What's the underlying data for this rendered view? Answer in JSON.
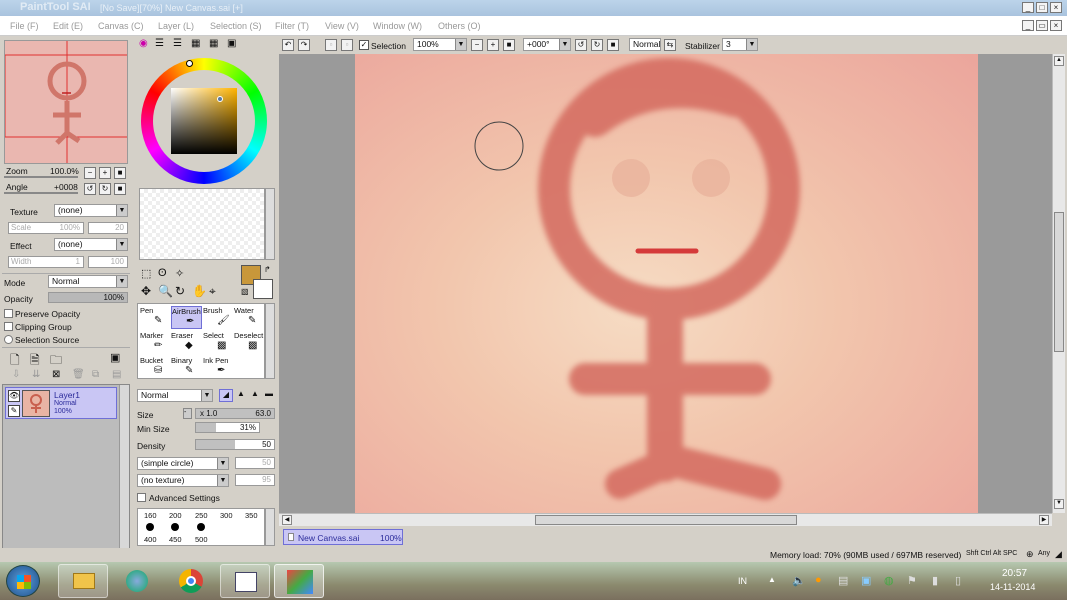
{
  "window": {
    "app_name": "PaintTool SAI",
    "title": "[No Save][70%] New Canvas.sai [+]"
  },
  "menu": [
    "File (F)",
    "Edit (E)",
    "Canvas (C)",
    "Layer (L)",
    "Selection (S)",
    "Filter (T)",
    "View (V)",
    "Window (W)",
    "Others (O)"
  ],
  "navigator": {
    "zoom_label": "Zoom",
    "zoom_value": "100.0%",
    "angle_label": "Angle",
    "angle_value": "+0008"
  },
  "texture": {
    "label": "Texture",
    "value": "(none)",
    "scale_label": "Scale",
    "scale_value": "100%",
    "scale_num": "20"
  },
  "effect": {
    "label": "Effect",
    "value": "(none)",
    "width_label": "Width",
    "width_value": "1",
    "width_num": "100"
  },
  "layer_props": {
    "mode_label": "Mode",
    "mode_value": "Normal",
    "opacity_label": "Opacity",
    "opacity_value": "100%",
    "opacity_fraction": 1.0,
    "preserve_opacity": "Preserve Opacity",
    "clipping_group": "Clipping Group",
    "selection_source": "Selection Source"
  },
  "layers": [
    {
      "name": "Layer1",
      "mode": "Normal",
      "opacity": "100%"
    }
  ],
  "brush_tools": [
    {
      "name": "Pen"
    },
    {
      "name": "AirBrush"
    },
    {
      "name": "Brush"
    },
    {
      "name": "Water"
    },
    {
      "name": "Marker"
    },
    {
      "name": "Eraser"
    },
    {
      "name": "Select"
    },
    {
      "name": "Deselect"
    },
    {
      "name": "Bucket"
    },
    {
      "name": "Binary"
    },
    {
      "name": "Ink Pen"
    }
  ],
  "brush_settings": {
    "blend_mode": "Normal",
    "size_label": "Size",
    "size_multiplier": "x 1.0",
    "size_value": "63.0",
    "min_size_label": "Min Size",
    "min_size_value": "31%",
    "min_size_fraction": 0.31,
    "density_label": "Density",
    "density_value": "50",
    "density_fraction": 0.5,
    "shape": "(simple circle)",
    "shape_value": "50",
    "texture": "(no texture)",
    "texture_value": "95",
    "advanced_settings": "Advanced Settings",
    "brush_sizes_row1": [
      "160",
      "200",
      "250",
      "300",
      "350"
    ],
    "brush_sizes_row2": [
      "400",
      "450",
      "500"
    ]
  },
  "colors": {
    "primary": "#c8973a",
    "secondary": "#ffffff",
    "canvas_bg": "#f2c6ad",
    "stroke": "#d46a5e",
    "mouth": "#d53a3a",
    "accent": "#3a6ea5"
  },
  "toolbar": {
    "selection_label": "Selection",
    "zoom_value": "100%",
    "angle_value": "+000°",
    "blend_mode": "Normal",
    "stabilizer_label": "Stabilizer",
    "stabilizer_value": "3"
  },
  "tab": {
    "name": "New Canvas.sai",
    "zoom": "100%"
  },
  "status": {
    "memory": "Memory load: 70% (90MB used / 697MB reserved)",
    "keys": "Shft Ctrl Alt SPC"
  },
  "taskbar": {
    "language": "IN",
    "time": "20:57",
    "date": "14-11-2014"
  }
}
